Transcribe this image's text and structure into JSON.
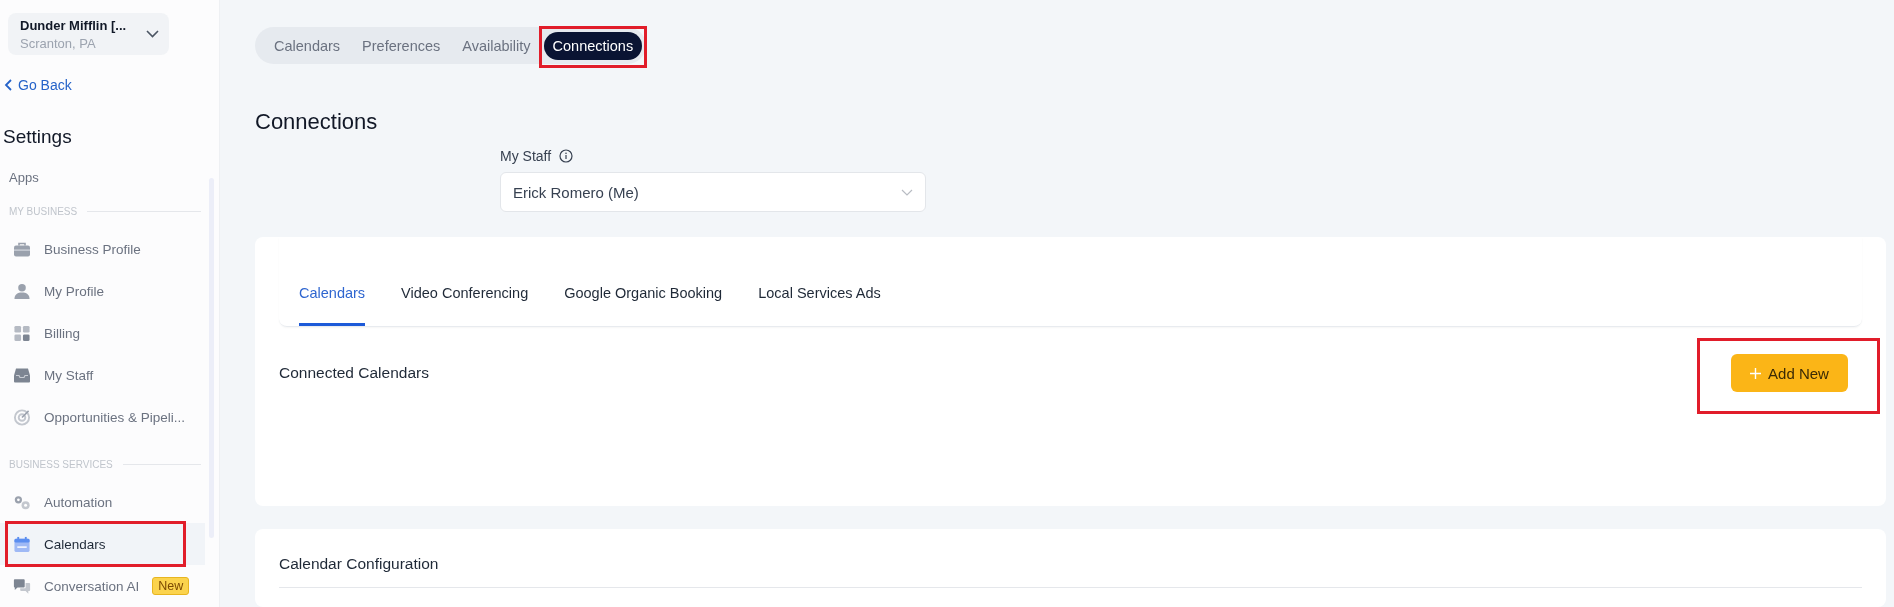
{
  "location_switcher": {
    "name": "Dunder Mifflin [...",
    "address": "Scranton, PA"
  },
  "back_link": "Go Back",
  "sidebar": {
    "title": "Settings",
    "items": [
      {
        "label": "Apps",
        "selected": false
      }
    ],
    "sections": [
      {
        "heading": "MY BUSINESS",
        "items": [
          {
            "label": "Business Profile",
            "selected": false,
            "highlighted": false
          },
          {
            "label": "My Profile",
            "selected": false,
            "highlighted": false
          },
          {
            "label": "Billing",
            "selected": false,
            "highlighted": false
          },
          {
            "label": "My Staff",
            "selected": false,
            "highlighted": false
          },
          {
            "label": "Opportunities & Pipeli...",
            "selected": false,
            "highlighted": false
          }
        ]
      },
      {
        "heading": "BUSINESS SERVICES",
        "items": [
          {
            "label": "Automation",
            "selected": false,
            "highlighted": false
          },
          {
            "label": "Calendars",
            "selected": true,
            "highlighted": true
          },
          {
            "label": "Conversation AI",
            "badge": "New",
            "selected": false,
            "highlighted": false
          }
        ]
      }
    ]
  },
  "top_tabs": [
    {
      "label": "Calendars",
      "selected": false,
      "highlighted": false
    },
    {
      "label": "Preferences",
      "selected": false,
      "highlighted": false
    },
    {
      "label": "Availability",
      "selected": false,
      "highlighted": false
    },
    {
      "label": "Connections",
      "selected": true,
      "highlighted": true
    }
  ],
  "page_title": "Connections",
  "staff_field": {
    "label": "My Staff",
    "value": "Erick Romero (Me)"
  },
  "connections_card": {
    "tabs": [
      {
        "label": "Calendars",
        "selected": true
      },
      {
        "label": "Video Conferencing",
        "selected": false
      },
      {
        "label": "Google Organic Booking",
        "selected": false
      },
      {
        "label": "Local Services Ads",
        "selected": false
      }
    ],
    "heading": "Connected Calendars",
    "add_button": {
      "label": "Add New",
      "highlighted": true
    }
  },
  "config_card": {
    "heading": "Calendar Configuration"
  }
}
